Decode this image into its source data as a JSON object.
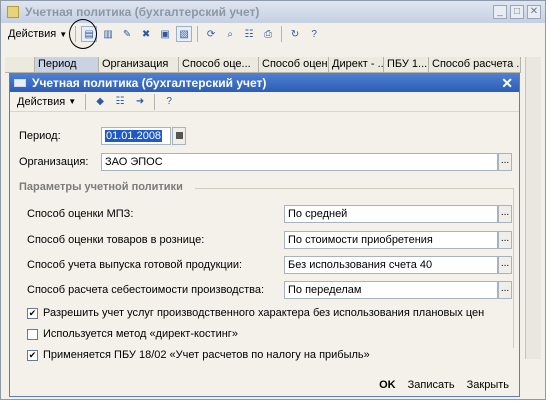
{
  "bg_window": {
    "title": "Учетная политика (бухгалтерский учет)",
    "actions_label": "Действия",
    "columns": [
      "Период",
      "Организация",
      "Способ оце...",
      "Способ оценк...",
      "Директ - ...",
      "ПБУ 1...",
      "Способ расчета ..."
    ]
  },
  "dialog": {
    "title": "Учетная политика (бухгалтерский учет)",
    "actions_label": "Действия",
    "period_label": "Период:",
    "period_value": "01.01.2008",
    "org_label": "Организация:",
    "org_value": "ЗАО ЭПОС",
    "section_title": "Параметры учетной политики",
    "params": [
      {
        "label": "Способ оценки МПЗ:",
        "value": "По средней"
      },
      {
        "label": "Способ оценки товаров в рознице:",
        "value": "По стоимости приобретения"
      },
      {
        "label": "Способ учета выпуска готовой продукции:",
        "value": "Без использования счета 40"
      },
      {
        "label": "Способ расчета себестоимости производства:",
        "value": "По переделам"
      }
    ],
    "checks": [
      {
        "label": "Разрешить учет услуг производственного характера без использования плановых цен",
        "checked": true
      },
      {
        "label": "Используется метод «директ-костинг»",
        "checked": false
      },
      {
        "label": "Применяется ПБУ 18/02 «Учет расчетов по налогу на прибыль»",
        "checked": true
      }
    ],
    "ok_label": "OK",
    "save_label": "Записать",
    "close_label": "Закрыть"
  }
}
